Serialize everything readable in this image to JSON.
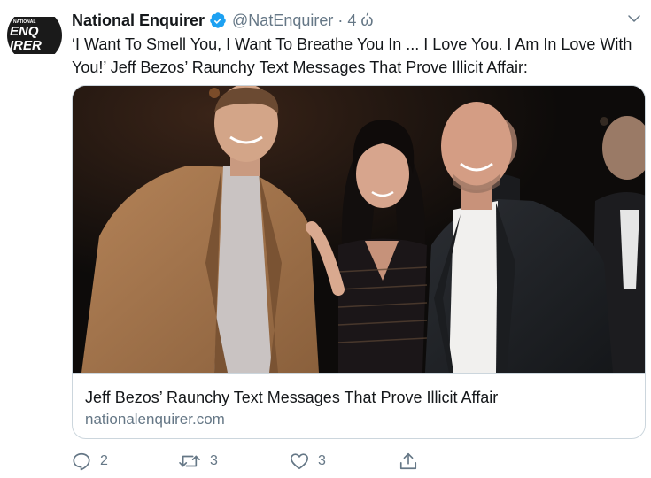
{
  "account": {
    "display_name": "National Enquirer",
    "handle": "@NatEnquirer",
    "separator": "·",
    "time": "4 ώ",
    "avatar_small_text": "NATIONAL",
    "avatar_text_line1": "ENQ",
    "avatar_text_line2": "IRER"
  },
  "tweet": {
    "text": "‘I Want To Smell You, I Want To Breathe You In ... I Love You. I Am In Love With You!’ Jeff Bezos’ Raunchy Text Messages That Prove Illicit Affair:"
  },
  "card": {
    "title": "Jeff Bezos’ Raunchy Text Messages That Prove Illicit Affair",
    "domain": "nationalenquirer.com"
  },
  "actions": {
    "reply_count": "2",
    "retweet_count": "3",
    "like_count": "3"
  },
  "colors": {
    "verified_blue": "#1da1f2",
    "secondary_text": "#657786",
    "border": "#ccd6dd"
  },
  "icons": {
    "verified": "verified-badge-icon",
    "caret": "chevron-down-icon",
    "reply": "reply-icon",
    "retweet": "retweet-icon",
    "like": "heart-icon",
    "share": "share-icon"
  }
}
